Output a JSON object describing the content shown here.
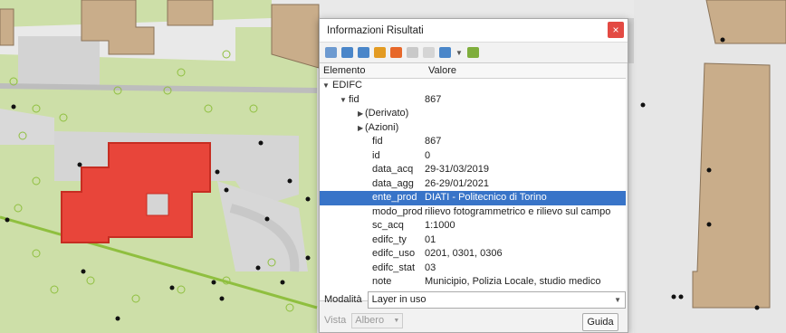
{
  "panel": {
    "title": "Informazioni Risultati",
    "close_label": "×",
    "header": {
      "col1": "Elemento",
      "col2": "Valore"
    },
    "tree": [
      {
        "key": "EDIFC",
        "value": "",
        "indent": 0,
        "arrow": "down"
      },
      {
        "key": "fid",
        "value": "867",
        "indent": 1,
        "arrow": "down"
      },
      {
        "key": "(Derivato)",
        "value": "",
        "indent": 2,
        "arrow": "right"
      },
      {
        "key": "(Azioni)",
        "value": "",
        "indent": 2,
        "arrow": "right"
      },
      {
        "key": "fid",
        "value": "867",
        "indent": 3
      },
      {
        "key": "id",
        "value": "0",
        "indent": 3
      },
      {
        "key": "data_acq",
        "value": "29-31/03/2019",
        "indent": 3
      },
      {
        "key": "data_agg",
        "value": "26-29/01/2021",
        "indent": 3
      },
      {
        "key": "ente_prod",
        "value": "DIATI - Politecnico di Torino",
        "indent": 3,
        "selected": true
      },
      {
        "key": "modo_prod",
        "value": "rilievo fotogrammetrico e rilievo sul campo",
        "indent": 3
      },
      {
        "key": "sc_acq",
        "value": "1:1000",
        "indent": 3
      },
      {
        "key": "edifc_ty",
        "value": "01",
        "indent": 3
      },
      {
        "key": "edifc_uso",
        "value": "0201, 0301, 0306",
        "indent": 3
      },
      {
        "key": "edifc_stat",
        "value": "03",
        "indent": 3
      },
      {
        "key": "note",
        "value": "Municipio, Polizia Locale, studio medico",
        "indent": 3
      }
    ],
    "modalita_label": "Modalità",
    "modalita_value": "Layer in uso",
    "vista_label": "Vista",
    "vista_value": "Albero",
    "help_label": "Guida"
  },
  "colors": {
    "map_bg": "#e9e9e9",
    "green": "#cddfa8",
    "building": "#c9ad8a",
    "selected_feature": "#e8453a",
    "selection_row": "#3874c8"
  }
}
